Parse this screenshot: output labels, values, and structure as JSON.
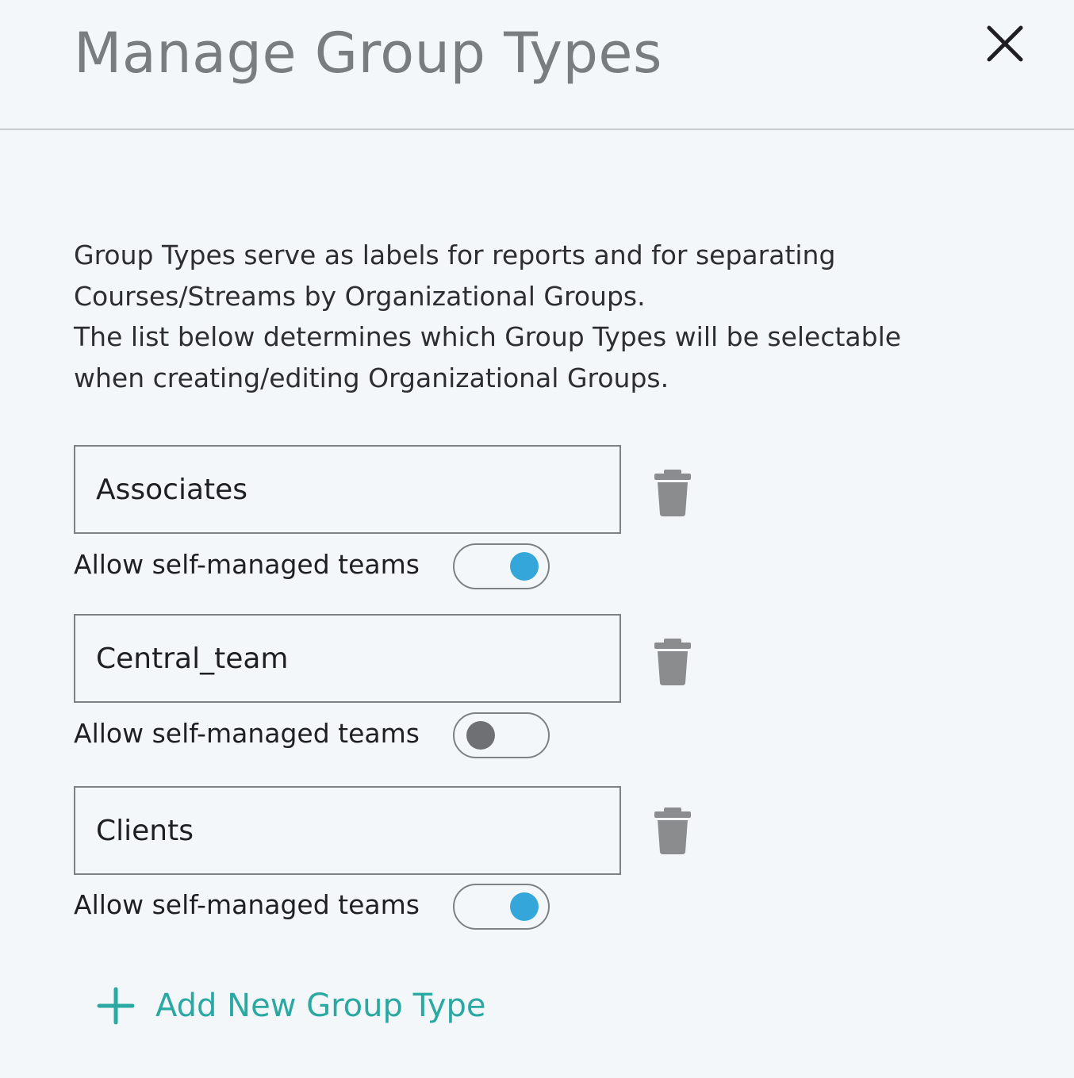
{
  "dialog": {
    "title": "Manage Group Types",
    "close_icon": "close-icon"
  },
  "description": {
    "line1": "Group Types serve as labels for reports and for separating",
    "line2": "Courses/Streams by Organizational Groups.",
    "line3": "The list below determines which Group Types will be selectable",
    "line4": "when creating/editing Organizational Groups."
  },
  "group_types": [
    {
      "name": "Associates",
      "toggle_label": "Allow self-managed teams",
      "self_managed": true
    },
    {
      "name": "Central_team",
      "toggle_label": "Allow self-managed teams",
      "self_managed": false
    },
    {
      "name": "Clients",
      "toggle_label": "Allow self-managed teams",
      "self_managed": true
    }
  ],
  "add_button": {
    "label": "Add New Group Type",
    "icon": "plus-icon"
  },
  "colors": {
    "accent": "#2aa9a2",
    "toggle_on": "#35a6da",
    "toggle_off": "#6e7073",
    "background": "#f4f7fa"
  }
}
